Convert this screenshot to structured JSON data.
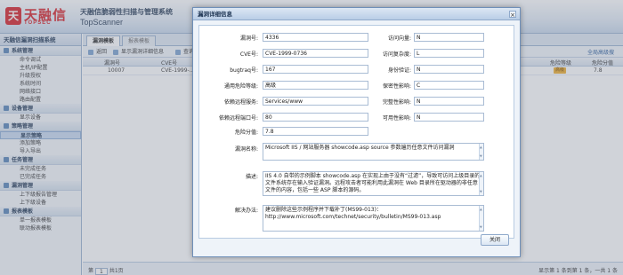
{
  "banner": {
    "logo_char": "天",
    "logo_text": "天融信",
    "logo_sub": "TOPSEC",
    "system_title": "天融信脆弱性扫描与管理系统",
    "system_sub": "TopScanner"
  },
  "sidebar": {
    "title": "天融信漏洞扫描系统",
    "groups": [
      {
        "label": "系统管理",
        "items": [
          "命令调试",
          "主机/IP配置",
          "升级授权",
          "系统时间",
          "网络接口",
          "路由配置"
        ]
      },
      {
        "label": "设备管理",
        "items": [
          "显示设备"
        ]
      },
      {
        "label": "策略管理",
        "items": [
          "显示策略",
          "添加策略",
          "导入导出"
        ]
      },
      {
        "label": "任务管理",
        "items": [
          "未完成任务",
          "已完成任务"
        ]
      },
      {
        "label": "漏洞管理",
        "items": [
          "上下级报告管理",
          "上下级设备"
        ]
      },
      {
        "label": "报表模板",
        "items": [
          "单一报表模板",
          "联动报表模板"
        ]
      }
    ]
  },
  "tabs": {
    "active": "漏洞模板",
    "other": "报表模板"
  },
  "toolbar": {
    "back": "返回",
    "show_detail": "显示漏洞详细信息",
    "search": "查询",
    "right": "全局高级搜"
  },
  "grid": {
    "headers": [
      "漏洞号",
      "CVE号",
      "危险等级",
      "危险分值"
    ],
    "row": {
      "id": "10007",
      "cve": "CVE-1999-...",
      "risk": "高级",
      "score": "7.8"
    }
  },
  "pager": {
    "page_label": "第",
    "page": "1",
    "page_total": "共1页",
    "right": "显示第 1 条到第 1 条，一共 1 条"
  },
  "modal": {
    "title": "漏洞详细信息",
    "fields": {
      "vuln_no_label": "漏洞号:",
      "vuln_no": "4336",
      "cve_label": "CVE号:",
      "cve": "CVE-1999-0736",
      "bugtraq_label": "bugtraq号:",
      "bugtraq": "167",
      "risk_level_label": "通用危险等级:",
      "risk_level": "高级",
      "dep_service_label": "依赖远程服务:",
      "dep_service": "Services/www",
      "dep_port_label": "依赖远程端口号:",
      "dep_port": "80",
      "risk_score_label": "危险分值:",
      "risk_score": "7.8",
      "access_vector_label": "访问向量:",
      "access_vector": "N",
      "access_complexity_label": "访问复杂度:",
      "access_complexity": "L",
      "authentication_label": "身份验证:",
      "authentication": "N",
      "confidentiality_label": "保密性影响:",
      "confidentiality": "C",
      "integrity_label": "完整性影响:",
      "integrity": "N",
      "availability_label": "可用性影响:",
      "availability": "N",
      "name_label": "漏洞名称:",
      "name": "Microsoft IIS / 网站服务器 showcode.asp source 参数遍历任意文件访问漏洞",
      "description_label": "描述:",
      "description": "IIS 4.0 自带的示例脚本 showcode.asp 在实现上由于没有“过滤”，导致可访问上级目录的文件系统存在输入验证漏洞。远程攻击者可能利用此漏洞在 Web 目录所在驱动器的非任意文件的内容，包括一些 ASP 脚本的源码。",
      "solution_label": "解决办法:",
      "solution": "建议删除这些示例程序并下载补丁(MS99-013)：http://www.microsoft.com/technet/security/bulletin/MS99-013.asp"
    },
    "close_label": "关闭"
  }
}
